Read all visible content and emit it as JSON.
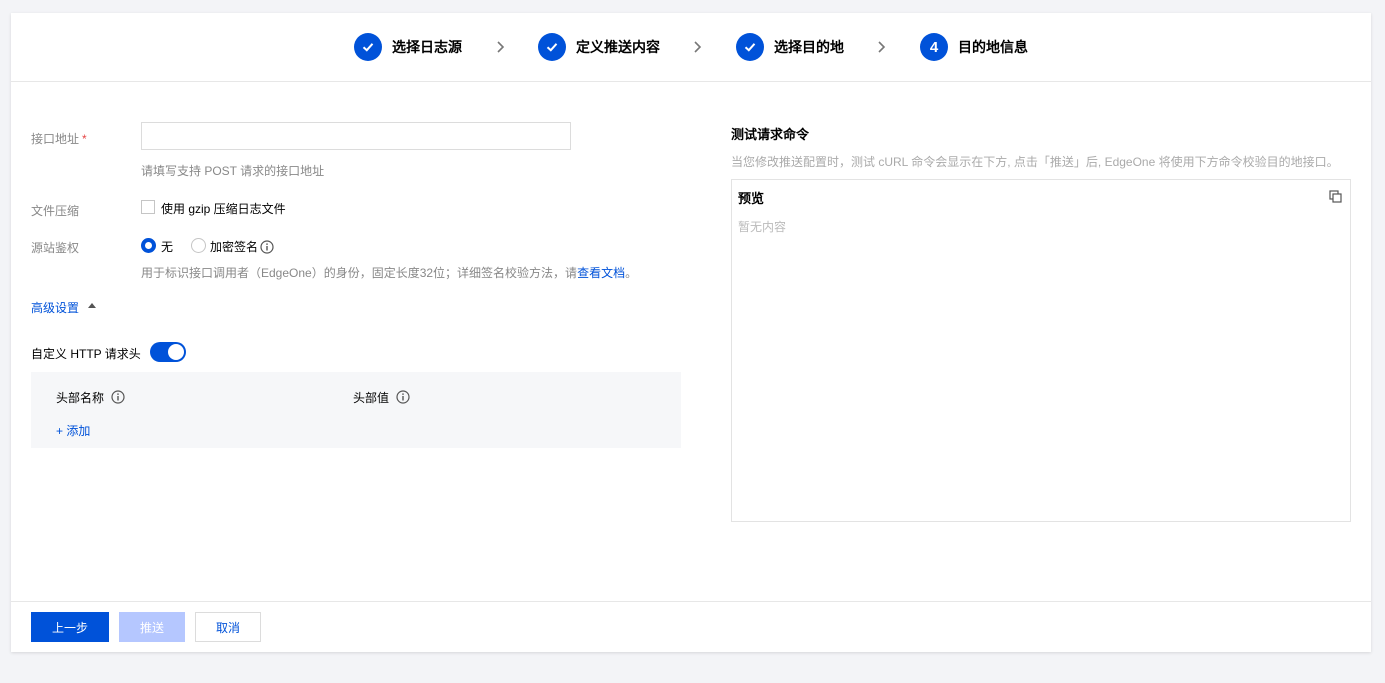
{
  "steps": [
    {
      "label": "选择日志源",
      "state": "done"
    },
    {
      "label": "定义推送内容",
      "state": "done"
    },
    {
      "label": "选择目的地",
      "state": "done"
    },
    {
      "label": "目的地信息",
      "state": "current",
      "number": "4"
    }
  ],
  "form": {
    "endpoint": {
      "label": "接口地址",
      "required_mark": "*",
      "value": "",
      "placeholder": "",
      "hint": "请填写支持 POST 请求的接口地址"
    },
    "compression": {
      "label": "文件压缩",
      "checkbox_label": "使用 gzip 压缩日志文件",
      "checked": false
    },
    "auth": {
      "label": "源站鉴权",
      "options": [
        {
          "label": "无",
          "selected": true
        },
        {
          "label": "加密签名",
          "selected": false
        }
      ],
      "hint_prefix": "用于标识接口调用者（EdgeOne）的身份，固定长度32位；详细签名校验方法，请",
      "hint_link": "查看文档",
      "hint_suffix": "。"
    },
    "advanced": {
      "label": "高级设置",
      "expanded": true
    },
    "custom_headers": {
      "label": "自定义 HTTP 请求头",
      "enabled": true,
      "col_name": "头部名称",
      "col_value": "头部值",
      "add_label": "+ 添加"
    }
  },
  "test_panel": {
    "title": "测试请求命令",
    "description": "当您修改推送配置时，测试 cURL 命令会显示在下方, 点击「推送」后, EdgeOne 将使用下方命令校验目的地接口。",
    "preview_title": "预览",
    "empty_text": "暂无内容"
  },
  "footer": {
    "prev_label": "上一步",
    "push_label": "推送",
    "cancel_label": "取消"
  },
  "colors": {
    "accent": "#0052d9",
    "disabled": "#b5c7ff",
    "required": "#e54545"
  }
}
